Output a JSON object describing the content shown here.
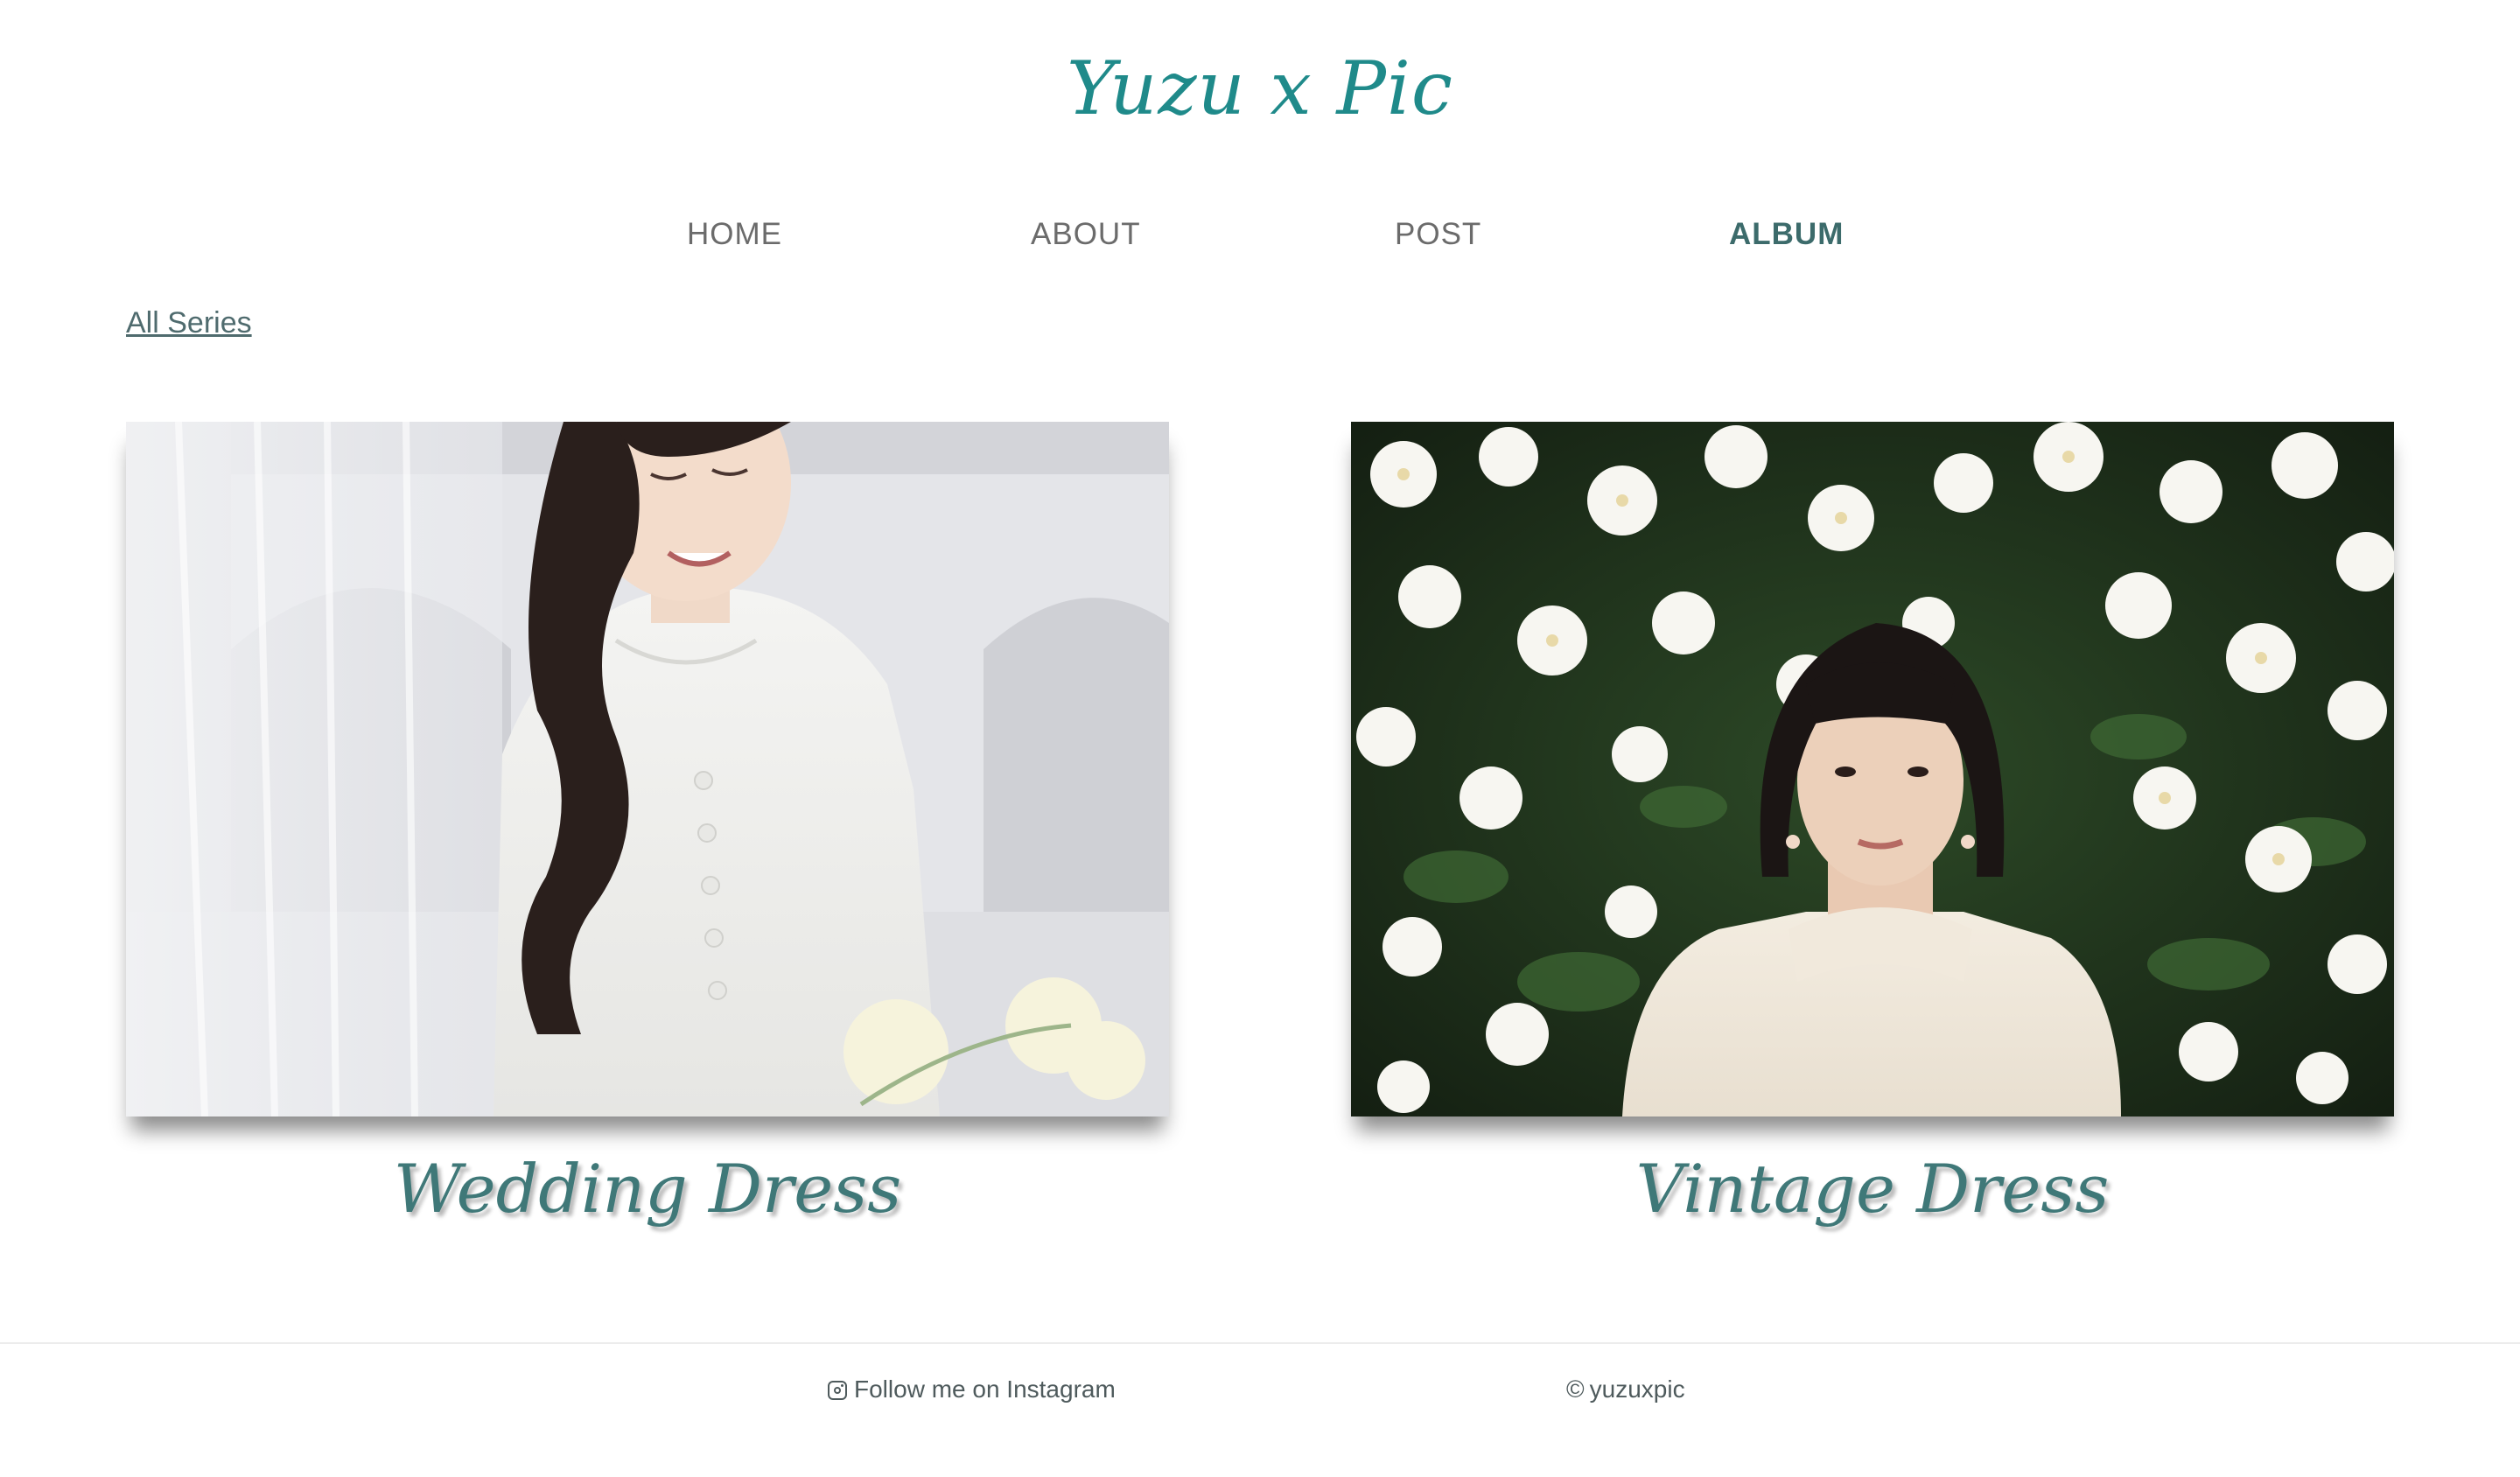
{
  "site": {
    "brand": "Yuzu x Pic"
  },
  "nav": {
    "items": [
      {
        "label": "HOME",
        "active": false
      },
      {
        "label": "ABOUT",
        "active": false
      },
      {
        "label": "POST",
        "active": false
      },
      {
        "label": "ALBUM",
        "active": true
      }
    ]
  },
  "breadcrumb": {
    "label": "All Series"
  },
  "albums": [
    {
      "title": "Wedding Dress",
      "image_icon": "photo-woman-white-dress"
    },
    {
      "title": "Vintage Dress",
      "image_icon": "photo-woman-magnolia-flowers"
    }
  ],
  "footer": {
    "instagram_label": "Follow me on Instagram",
    "instagram_icon": "instagram-icon",
    "copyright_symbol": "©",
    "copyright_label": "yuzuxpic"
  },
  "colors": {
    "brand": "#1f8a8a",
    "active_nav": "#3c6b6b",
    "title": "#3f7878"
  }
}
